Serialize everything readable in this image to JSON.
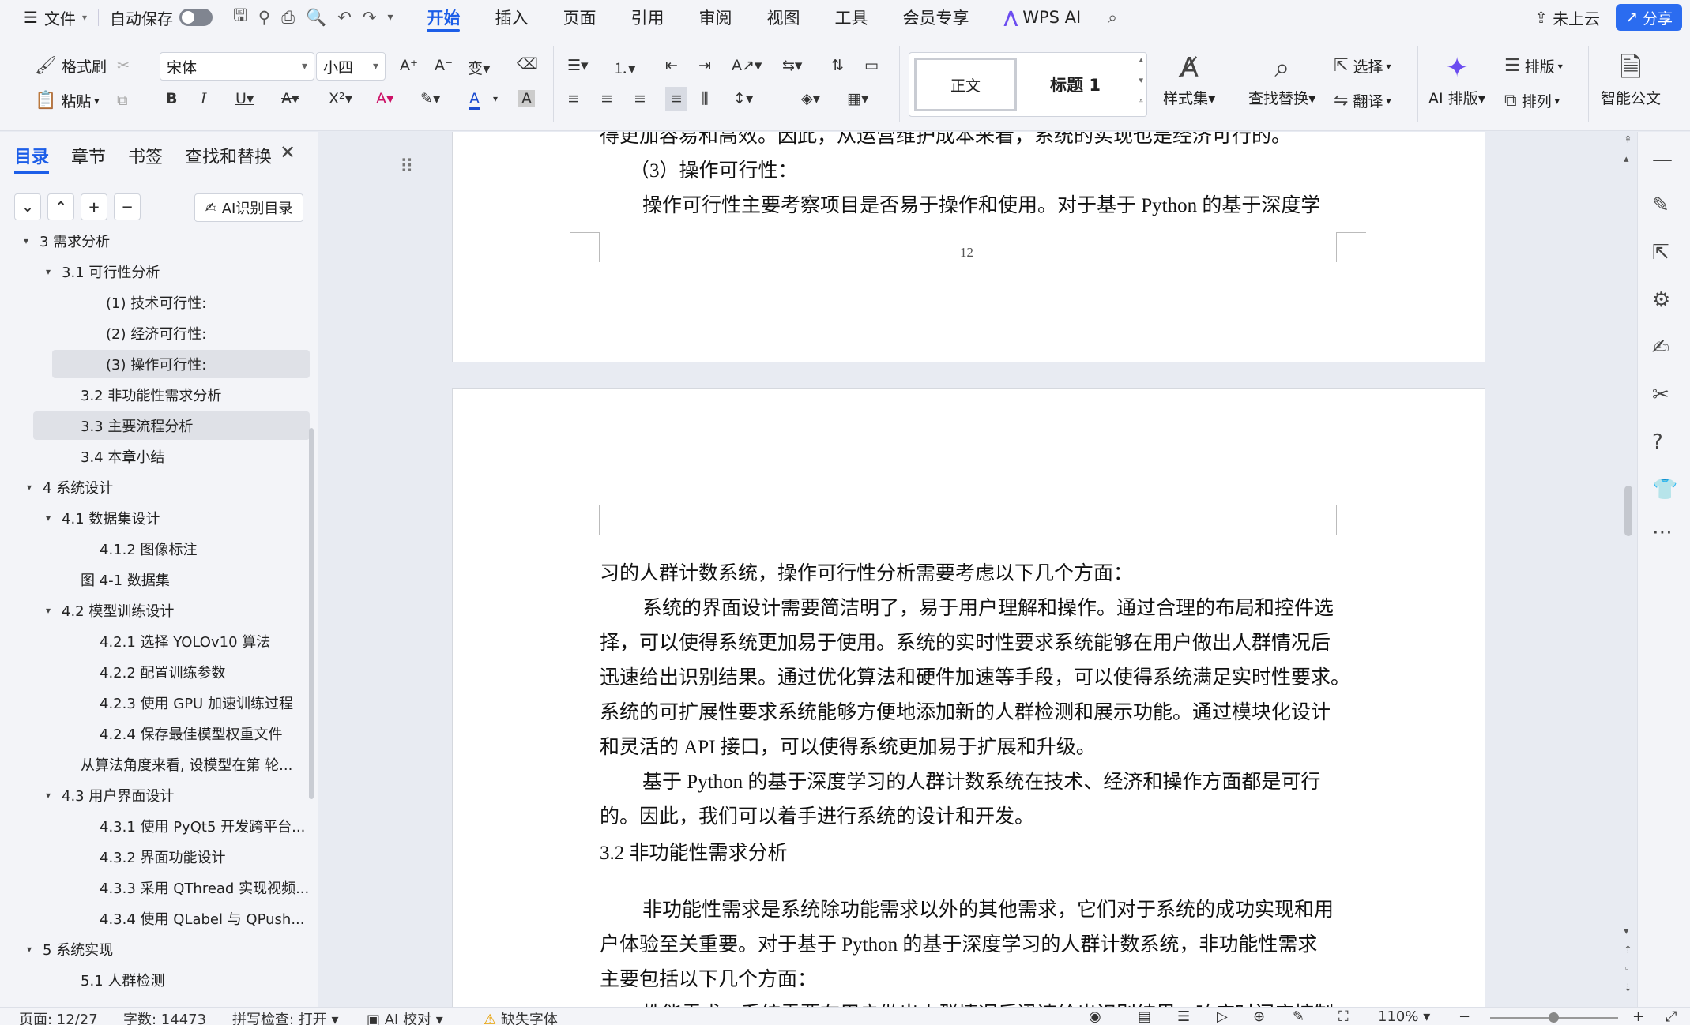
{
  "menubar": {
    "file_label": "文件",
    "autosave_label": "自动保存",
    "tabs": [
      "开始",
      "插入",
      "页面",
      "引用",
      "审阅",
      "视图",
      "工具",
      "会员专享",
      "WPS AI"
    ],
    "cloud_label": "未上云",
    "share_label": "分享"
  },
  "ribbon": {
    "format_painter": "格式刷",
    "paste": "粘贴",
    "font_name": "宋体",
    "font_size": "小四",
    "style_normal": "正文",
    "style_heading1": "标题 1",
    "style_set": "样式集",
    "find_replace": "查找替换",
    "select": "选择",
    "translate": "翻译",
    "ai_layout": "AI 排版",
    "layout": "排版",
    "arrange": "排列",
    "smart_doc": "智能公文"
  },
  "nav": {
    "tabs": [
      "目录",
      "章节",
      "书签",
      "查找和替换"
    ],
    "ai_toc_label": "AI识别目录",
    "toc": [
      {
        "text": "3 需求分析",
        "arrow": "▾"
      },
      {
        "text": "3.1 可行性分析",
        "arrow": "▾"
      },
      {
        "text": "(1) 技术可行性:",
        "arrow": ""
      },
      {
        "text": "(2) 经济可行性:",
        "arrow": ""
      },
      {
        "text": "(3) 操作可行性:",
        "arrow": ""
      },
      {
        "text": "3.2  非功能性需求分析",
        "arrow": ""
      },
      {
        "text": "3.3 主要流程分析",
        "arrow": ""
      },
      {
        "text": "3.4 本章小结",
        "arrow": ""
      },
      {
        "text": "4  系统设计",
        "arrow": "▾"
      },
      {
        "text": "4.1  数据集设计",
        "arrow": "▾"
      },
      {
        "text": "4.1.2 图像标注",
        "arrow": ""
      },
      {
        "text": "图 4-1  数据集",
        "arrow": ""
      },
      {
        "text": "4.2  模型训练设计",
        "arrow": "▾"
      },
      {
        "text": "4.2.1  选择  YOLOv10  算法",
        "arrow": ""
      },
      {
        "text": "4.2.2  配置训练参数",
        "arrow": ""
      },
      {
        "text": "4.2.3  使用  GPU  加速训练过程",
        "arrow": ""
      },
      {
        "text": "4.2.4  保存最佳模型权重文件",
        "arrow": ""
      },
      {
        "text": "从算法角度来看, 设模型在第 轮...",
        "arrow": ""
      },
      {
        "text": "4.3 用户界面设计",
        "arrow": "▾"
      },
      {
        "text": "4.3.1  使用  PyQt5  开发跨平台...",
        "arrow": ""
      },
      {
        "text": "4.3.2  界面功能设计",
        "arrow": ""
      },
      {
        "text": "4.3.3  采用  QThread  实现视频...",
        "arrow": ""
      },
      {
        "text": "4.3.4  使用  QLabel  与  QPush...",
        "arrow": ""
      },
      {
        "text": "5 系统实现",
        "arrow": "▾"
      },
      {
        "text": "5.1 人群检测",
        "arrow": ""
      }
    ]
  },
  "document": {
    "page1_lines": [
      "得更加容易和高效。因此，从运营维护成本来看，系统的实现也是经济可行的。",
      "（3）操作可行性：",
      "操作可行性主要考察项目是否易于操作和使用。对于基于 Python 的基于深度学"
    ],
    "page1_number": "12",
    "page2_lines": [
      "习的人群计数系统，操作可行性分析需要考虑以下几个方面：",
      "系统的界面设计需要简洁明了，易于用户理解和操作。通过合理的布局和控件选",
      "择，可以使得系统更加易于使用。系统的实时性要求系统能够在用户做出人群情况后",
      "迅速给出识别结果。通过优化算法和硬件加速等手段，可以使得系统满足实时性要求。",
      "系统的可扩展性要求系统能够方便地添加新的人群检测和展示功能。通过模块化设计",
      "和灵活的 API 接口，可以使得系统更加易于扩展和升级。",
      "基于 Python 的基于深度学习的人群计数系统在技术、经济和操作方面都是可行",
      "的。因此，我们可以着手进行系统的设计和开发。",
      "3.2  非功能性需求分析",
      "非功能性需求是系统除功能需求以外的其他需求，它们对于系统的成功实现和用",
      "户体验至关重要。对于基于 Python 的基于深度学习的人群计数系统，非功能性需求",
      "主要包括以下几个方面：",
      "性能需求：系统需要在用户做出人群情况后迅速给出识别结果，响应时间应控制"
    ]
  },
  "statusbar": {
    "page": "页面: 12/27",
    "words": "字数: 14473",
    "spellcheck": "拼写检查: 打开",
    "ai_proof": "AI 校对",
    "missing_font": "缺失字体",
    "zoom": "110%"
  },
  "colors": {
    "accent": "#1c5ee8",
    "ui_bg": "#f3f4f8",
    "doc_bg": "#e8ebf2"
  }
}
